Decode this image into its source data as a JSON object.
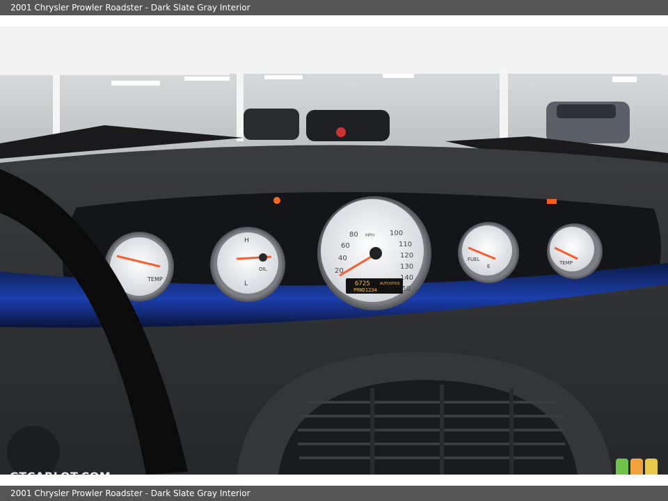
{
  "header": {
    "title": "2001 Chrysler Prowler Roadster - Dark Slate Gray Interior"
  },
  "footer": {
    "caption": "2001 Chrysler Prowler Roadster - Dark Slate Gray Interior"
  },
  "watermark": {
    "text": "GTCARLOT.COM"
  },
  "gauges": {
    "speedometer": {
      "ticks": [
        "20",
        "40",
        "60",
        "80",
        "100",
        "110",
        "120",
        "130",
        "140",
        "150"
      ],
      "odometer": "6725",
      "odometer_mode": "AUTOSTICK",
      "gear_display": "PRND1234",
      "unit_label": "MPH"
    },
    "left_gauge_label": "TEMP",
    "oil_gauge": {
      "high": "H",
      "low": "L",
      "label": "OIL"
    },
    "fuel_gauge": {
      "label": "FUEL",
      "empty": "E"
    },
    "right_gauge_label": "TEMP"
  },
  "colors": {
    "needle": "#ff5a2a",
    "trim_blue": "#1b3ea8",
    "dash": "#2f3033",
    "badge_green": "#6fc24a",
    "badge_orange": "#f2a23a",
    "badge_yellow": "#e8c94a"
  }
}
